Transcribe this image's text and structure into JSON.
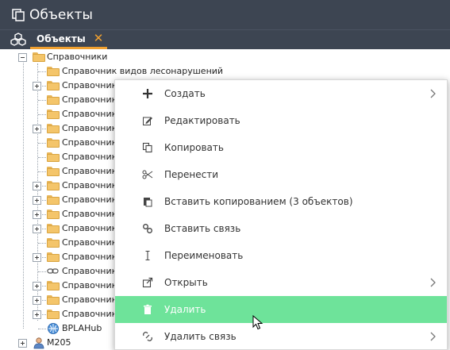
{
  "window": {
    "title": "Объекты"
  },
  "tab": {
    "label": "Объекты",
    "close_glyph": "✕"
  },
  "tree": [
    {
      "label": "Справочники",
      "depth": 0,
      "expander": "minus",
      "icon": "folder"
    },
    {
      "label": "Справочник видов лесонарушений",
      "depth": 1,
      "expander": "none",
      "icon": "folder"
    },
    {
      "label": "Справочник",
      "depth": 1,
      "expander": "plus",
      "icon": "folder"
    },
    {
      "label": "Справочник",
      "depth": 1,
      "expander": "none",
      "icon": "folder"
    },
    {
      "label": "Справочник",
      "depth": 1,
      "expander": "none",
      "icon": "folder"
    },
    {
      "label": "Справочник",
      "depth": 1,
      "expander": "plus",
      "icon": "folder"
    },
    {
      "label": "Справочник",
      "depth": 1,
      "expander": "none",
      "icon": "folder"
    },
    {
      "label": "Справочник",
      "depth": 1,
      "expander": "none",
      "icon": "folder"
    },
    {
      "label": "Справочник",
      "depth": 1,
      "expander": "none",
      "icon": "folder"
    },
    {
      "label": "Справочник",
      "depth": 1,
      "expander": "plus",
      "icon": "folder"
    },
    {
      "label": "Справочник",
      "depth": 1,
      "expander": "plus",
      "icon": "folder"
    },
    {
      "label": "Справочник",
      "depth": 1,
      "expander": "plus",
      "icon": "folder"
    },
    {
      "label": "Справочник",
      "depth": 1,
      "expander": "plus",
      "icon": "folder"
    },
    {
      "label": "Справочник",
      "depth": 1,
      "expander": "none",
      "icon": "folder"
    },
    {
      "label": "Справочник",
      "depth": 1,
      "expander": "plus",
      "icon": "folder"
    },
    {
      "label": "Справочник",
      "depth": 1,
      "expander": "none",
      "icon": "link"
    },
    {
      "label": "Справочник",
      "depth": 1,
      "expander": "plus",
      "icon": "folder"
    },
    {
      "label": "Справочник",
      "depth": 1,
      "expander": "plus",
      "icon": "folder"
    },
    {
      "label": "Справочник",
      "depth": 1,
      "expander": "plus",
      "icon": "folder"
    },
    {
      "label": "BPLAHub",
      "depth": 1,
      "expander": "none",
      "icon": "hub"
    },
    {
      "label": "M205",
      "depth": 0,
      "expander": "plus",
      "icon": "user"
    }
  ],
  "context_menu": {
    "items": [
      {
        "label": "Создать",
        "icon": "plus-icon",
        "submenu": true
      },
      {
        "label": "Редактировать",
        "icon": "edit-icon",
        "submenu": false
      },
      {
        "label": "Копировать",
        "icon": "copy-icon",
        "submenu": false
      },
      {
        "label": "Перенести",
        "icon": "scissors-icon",
        "submenu": false
      },
      {
        "label": "Вставить копированием (3 объектов)",
        "icon": "paste-icon",
        "submenu": false
      },
      {
        "label": "Вставить связь",
        "icon": "link-icon",
        "submenu": false
      },
      {
        "label": "Переименовать",
        "icon": "text-cursor-icon",
        "submenu": false
      },
      {
        "label": "Открыть",
        "icon": "open-icon",
        "submenu": true
      },
      {
        "label": "Удалить",
        "icon": "trash-icon",
        "submenu": false,
        "highlighted": true
      },
      {
        "label": "Удалить связь",
        "icon": "unlink-icon",
        "submenu": true
      }
    ],
    "highlight_color": "#6ee39a"
  },
  "colors": {
    "titlebar": "#3d4552",
    "accent": "#f0a030",
    "folder": "#f4c56a"
  }
}
